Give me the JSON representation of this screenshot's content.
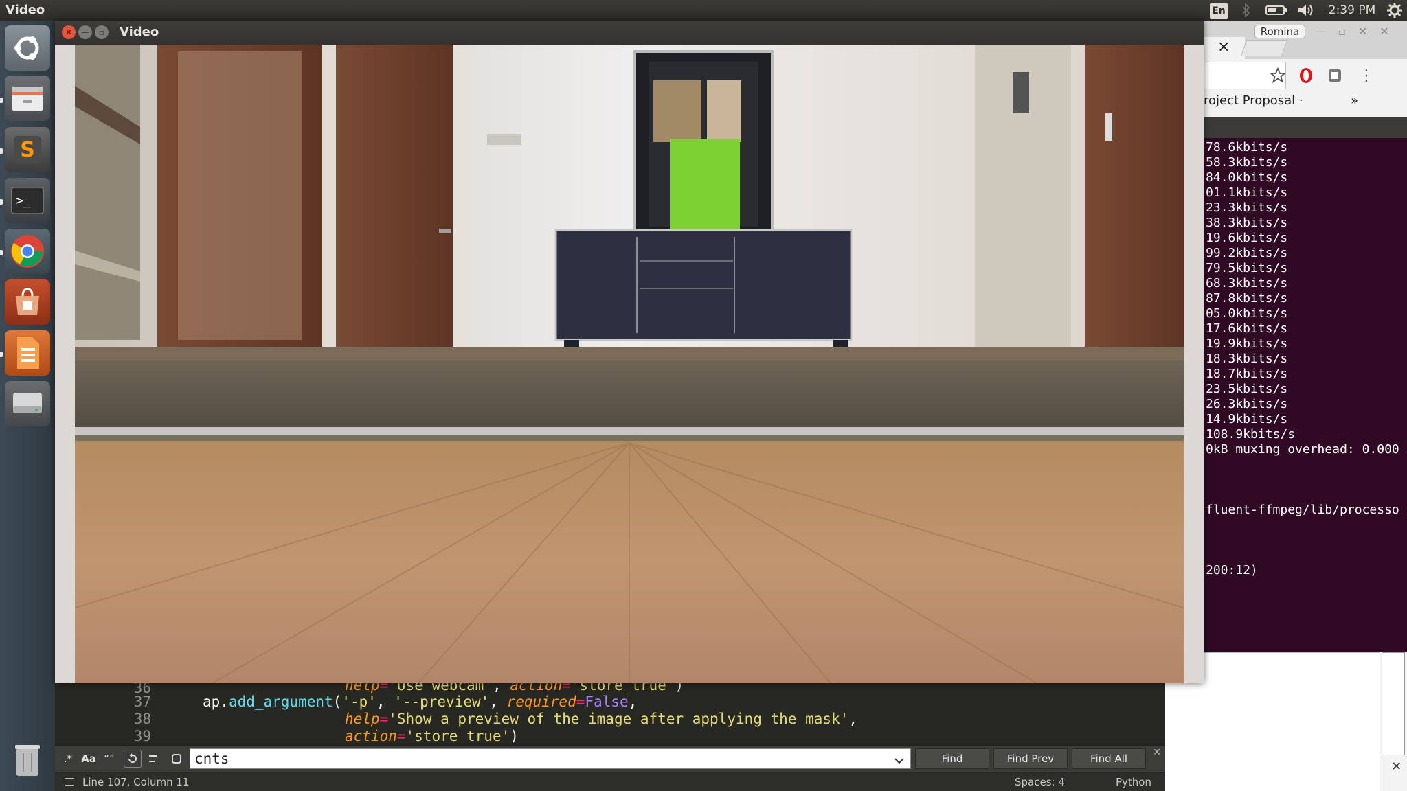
{
  "top_panel": {
    "app_title": "Video",
    "keyboard": "En",
    "clock": "2:39 PM",
    "icons": [
      "bluetooth-icon",
      "battery-icon",
      "volume-icon",
      "gear-icon"
    ]
  },
  "launcher": {
    "items": [
      "ubuntu-dash",
      "files",
      "sublime-text",
      "terminal",
      "chrome",
      "software-center",
      "libreoffice-impress",
      "disk",
      "trash"
    ]
  },
  "video_window": {
    "title": "Video"
  },
  "chrome": {
    "user": "Romina",
    "bookmark": "roject Proposal ·",
    "bookmark_more": "»",
    "tab_close": "×"
  },
  "terminal": {
    "lines": [
      "78.6kbits/s",
      "58.3kbits/s",
      "84.0kbits/s",
      "01.1kbits/s",
      "23.3kbits/s",
      "38.3kbits/s",
      "19.6kbits/s",
      "99.2kbits/s",
      "79.5kbits/s",
      "68.3kbits/s",
      "87.8kbits/s",
      "05.0kbits/s",
      "17.6kbits/s",
      "19.9kbits/s",
      "18.3kbits/s",
      "18.7kbits/s",
      "23.5kbits/s",
      "26.3kbits/s",
      "14.9kbits/s",
      "108.9kbits/s",
      "0kB muxing overhead: 0.000",
      "",
      "",
      "",
      "fluent-ffmpeg/lib/processo",
      "",
      "",
      "",
      "200:12)"
    ]
  },
  "editor": {
    "gutter": [
      "36",
      "37",
      "38",
      "39"
    ],
    "find_value": "cnts",
    "find_label": "Find",
    "find_prev_label": "Find Prev",
    "find_all_label": "Find All",
    "status_position": "Line 107, Column 11",
    "status_spaces": "Spaces: 4",
    "status_syntax": "Python",
    "toggles": [
      ".*",
      "Aa",
      "“”"
    ]
  }
}
